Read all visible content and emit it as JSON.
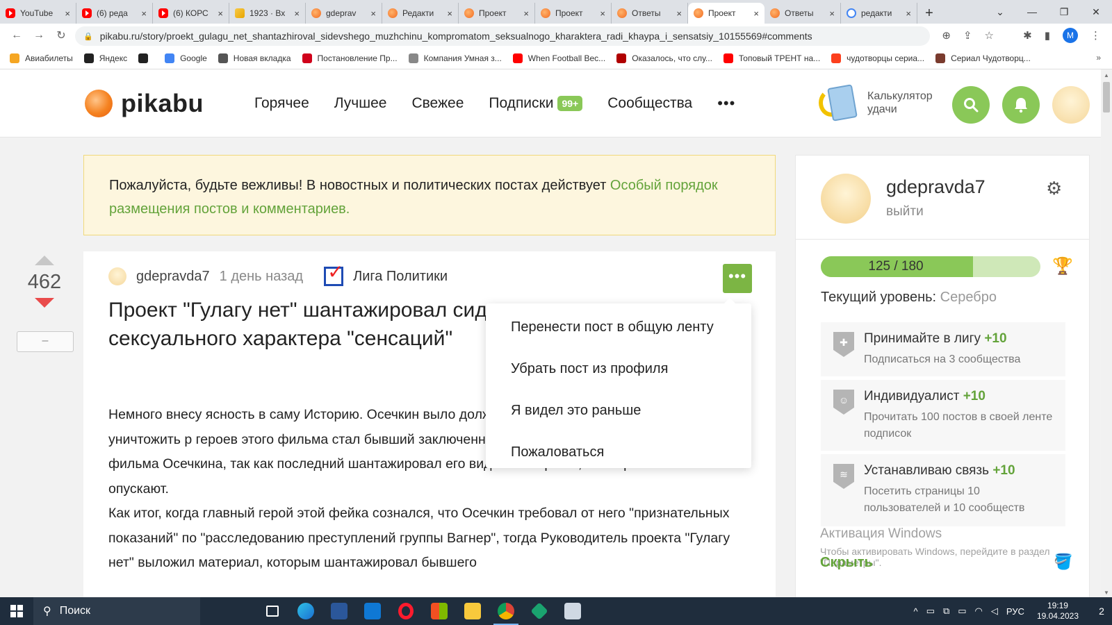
{
  "browser": {
    "tabs": [
      {
        "label": "YouTube",
        "favicon": "youtube-favicon"
      },
      {
        "label": "(6) реда",
        "favicon": "youtube-favicon"
      },
      {
        "label": "(6) КОРС",
        "favicon": "youtube-favicon"
      },
      {
        "label": "1923 · Вх",
        "favicon": "mail-favicon"
      },
      {
        "label": "gdeprav",
        "favicon": "pikabu-favicon"
      },
      {
        "label": "Редакти",
        "favicon": "pikabu-favicon"
      },
      {
        "label": "Проект",
        "favicon": "pikabu-favicon"
      },
      {
        "label": "Проект",
        "favicon": "pikabu-favicon"
      },
      {
        "label": "Ответы",
        "favicon": "pikabu-favicon"
      },
      {
        "label": "Проект",
        "favicon": "pikabu-favicon",
        "active": true
      },
      {
        "label": "Ответы",
        "favicon": "pikabu-favicon"
      },
      {
        "label": "редакти",
        "favicon": "google-favicon"
      }
    ],
    "tab_close": "×",
    "new_tab": "+",
    "url": "pikabu.ru/story/proekt_gulagu_net_shantazhiroval_sidevshego_muzhchinu_kompromatom_seksualnogo_kharaktera_radi_khaypa_i_sensatsiy_10155569#comments",
    "profile_initial": "M",
    "bookmarks": [
      {
        "label": "Авиабилеты",
        "color": "#f5a623"
      },
      {
        "label": "Яндекс",
        "color": "#222222"
      },
      {
        "label": "",
        "color": "#222222"
      },
      {
        "label": "Google",
        "color": "#4285f4"
      },
      {
        "label": "Новая вкладка",
        "color": "#555555"
      },
      {
        "label": "Постановление Пр...",
        "color": "#d0021b"
      },
      {
        "label": "Компания Умная з...",
        "color": "#888888"
      },
      {
        "label": "When Football Bec...",
        "color": "#ff0000"
      },
      {
        "label": "Оказалось, что слу...",
        "color": "#b00000"
      },
      {
        "label": "Топовый ТРЕНТ на...",
        "color": "#ff0000"
      },
      {
        "label": "чудотворцы сериа...",
        "color": "#fc3f1d"
      },
      {
        "label": "Сериал Чудотворц...",
        "color": "#7a3b2e"
      }
    ],
    "bookmarks_more": "»"
  },
  "header": {
    "logo_text": "pikabu",
    "nav": [
      {
        "label": "Горячее"
      },
      {
        "label": "Лучшее"
      },
      {
        "label": "Свежее"
      },
      {
        "label": "Подписки",
        "badge": "99+"
      },
      {
        "label": "Сообщества"
      }
    ],
    "more_dots": "•••",
    "luck_calculator": "Калькулятор удачи"
  },
  "notice": {
    "text": "Пожалуйста, будьте вежливы! В новостных и политических постах действует ",
    "link": "Особый порядок размещения постов и комментариев."
  },
  "vote": {
    "count": "462",
    "minus": "–"
  },
  "post": {
    "author": "gdepravda7",
    "time": "1 день назад",
    "community": "Лига Политики",
    "title": "Проект \"Гулагу нет\" шантажировал сид компроматом сексуального характера \"сенсаций\"",
    "body": "Немного внесу ясность в саму Историю. Осечкин выло должен был по словам того же Осечкина уничтожить р героев этого фильма стал бывший заключенный, котор вынужден соврать для фильма Осечкина, так как последний шантажировал его видео из тюрьмы, в котором несчастного опускают.",
    "body2": "Как итог, когда главный герой этой фейка сознался, что Осечкин требовал от него \"признательных показаний\" по \"расследованию преступлений группы Вагнер\", тогда Руководитель проекта \"Гулагу нет\" выложил материал, которым шантажировал бывшего",
    "more_button": "•••"
  },
  "dropdown": {
    "items": [
      "Перенести пост в общую ленту",
      "Убрать пост из профиля",
      "Я видел это раньше",
      "Пожаловаться"
    ]
  },
  "sidebar": {
    "username": "gdepravda7",
    "logout": "выйти",
    "xp_text": "125 / 180",
    "xp_fraction": 0.694,
    "level_label": "Текущий уровень: ",
    "level_value": "Серебро",
    "tasks": [
      {
        "title": "Принимайте в лигу ",
        "points": "+10",
        "desc": "Подписаться на 3 сообщества"
      },
      {
        "title": "Индивидуалист ",
        "points": "+10",
        "desc": "Прочитать 100 постов в своей ленте подписок"
      },
      {
        "title": "Устанавливаю связь ",
        "points": "+10",
        "desc": "Посетить страницы 10 пользователей и 10 сообществ"
      }
    ]
  },
  "watermark": {
    "title": "Активация Windows",
    "text": "Чтобы активировать Windows, перейдите в раздел",
    "text2": "\"Параметры\".",
    "hide": "Скрыть"
  },
  "taskbar": {
    "search": "Поиск",
    "lang": "РУС",
    "time": "19:19",
    "date": "19.04.2023",
    "notifications": "2"
  },
  "colors": {
    "accent_green": "#8ac858",
    "link_green": "#63a33a",
    "notice_bg": "#fdf6de",
    "vote_down": "#e94b4b"
  }
}
